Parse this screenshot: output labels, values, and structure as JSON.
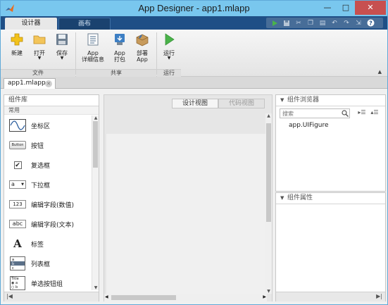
{
  "window": {
    "title": "App Designer - app1.mlapp"
  },
  "tabs": {
    "designer": "设计器",
    "layout": "画布"
  },
  "ribbon": {
    "new": "新建",
    "open": "打开",
    "save": "保存",
    "app_details_1": "App",
    "app_details_2": "详细信息",
    "package_1": "App",
    "package_2": "打包",
    "deploy_1": "部署",
    "deploy_2": "App",
    "run": "运行",
    "group_file": "文件",
    "group_share": "共享",
    "group_run": "运行"
  },
  "document": {
    "tab": "app1.mlapp"
  },
  "library": {
    "title": "组件库",
    "section": "常用",
    "items": [
      {
        "label": "坐标区",
        "icon": "axes-icon"
      },
      {
        "label": "按钮",
        "icon": "button-icon",
        "icon_text": "Button"
      },
      {
        "label": "复选框",
        "icon": "checkbox-icon"
      },
      {
        "label": "下拉框",
        "icon": "dropdown-icon",
        "icon_text": "a"
      },
      {
        "label": "编辑字段(数值)",
        "icon": "numeric-field-icon",
        "icon_text": "123"
      },
      {
        "label": "编辑字段(文本)",
        "icon": "text-field-icon",
        "icon_text": "abc"
      },
      {
        "label": "标签",
        "icon": "label-icon",
        "icon_text": "A"
      },
      {
        "label": "列表框",
        "icon": "listbox-icon"
      },
      {
        "label": "单选按钮组",
        "icon": "radio-group-icon",
        "icon_text": "Title"
      }
    ]
  },
  "canvas": {
    "design_view": "设计视图",
    "code_view": "代码视图"
  },
  "browser": {
    "title": "组件浏览器",
    "search_placeholder": "搜索",
    "root": "app.UIFigure"
  },
  "properties": {
    "title": "组件属性"
  },
  "colors": {
    "title_bar": "#79c7ee",
    "tab_strip": "#1f4f86",
    "close_button": "#c75050"
  }
}
